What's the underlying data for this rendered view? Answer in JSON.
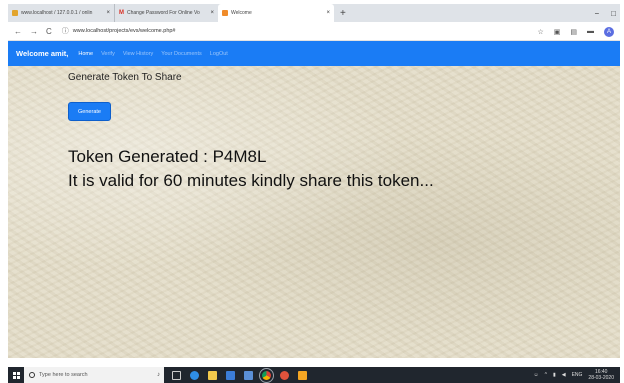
{
  "browser": {
    "tabs": [
      {
        "title": "www.localhost / 127.0.0.1 / onlin",
        "favicon_color": "#e2a42c"
      },
      {
        "title": "Change Password For Online Vo",
        "favicon_glyph": "M",
        "favicon_color": "#d93025"
      },
      {
        "title": "Welcome",
        "favicon_color": "#f08c2a",
        "active": true
      }
    ],
    "new_tab_glyph": "+",
    "window_controls": [
      "−",
      "□"
    ],
    "url": "www.localhost/projects/evs/welcome.php#",
    "profile_initial": "A"
  },
  "navbar": {
    "brand": "Welcome amit,",
    "links": [
      "Home",
      "Verify",
      "View History",
      "Your Documents",
      "LogOut"
    ],
    "active_link": "Home",
    "color": "#1a7cf5"
  },
  "main": {
    "heading": "Generate Token To Share",
    "generate_button": "Generate",
    "token_message": "Token Generated : P4M8L",
    "validity_message": "It is valid for 60 minutes kindly share this token..."
  },
  "taskbar": {
    "search_placeholder": "Type here to search",
    "language": "ENG",
    "time": "16:40",
    "date": "28-03-2020"
  }
}
